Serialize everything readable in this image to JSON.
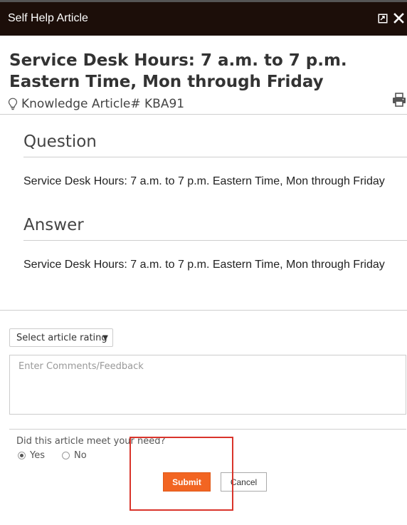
{
  "window": {
    "title": "Self Help Article",
    "icons": [
      "maximize-icon",
      "close-icon"
    ]
  },
  "article": {
    "title": "Service Desk Hours: 7 a.m. to 7 p.m. Eastern Time, Mon through Friday",
    "kb_label": "Knowledge Article# KBA91",
    "kb_icon": "lightbulb-icon",
    "print_icon": "print-icon"
  },
  "question": {
    "heading": "Question",
    "text": "Service Desk Hours: 7 a.m. to 7 p.m. Eastern Time, Mon through Friday"
  },
  "answer": {
    "heading": "Answer",
    "text": "Service Desk Hours: 7 a.m. to 7 p.m. Eastern Time, Mon through Friday"
  },
  "feedback": {
    "rating_placeholder": "Select article rating",
    "comments_placeholder": "Enter Comments/Feedback",
    "need_question": "Did this article meet your need?",
    "options": [
      {
        "label": "Yes",
        "checked": true
      },
      {
        "label": "No",
        "checked": false
      }
    ],
    "submit_label": "Submit",
    "cancel_label": "Cancel"
  },
  "colors": {
    "titlebar": "#1c0e09",
    "submit": "#f26522",
    "highlight": "#d9342b"
  }
}
